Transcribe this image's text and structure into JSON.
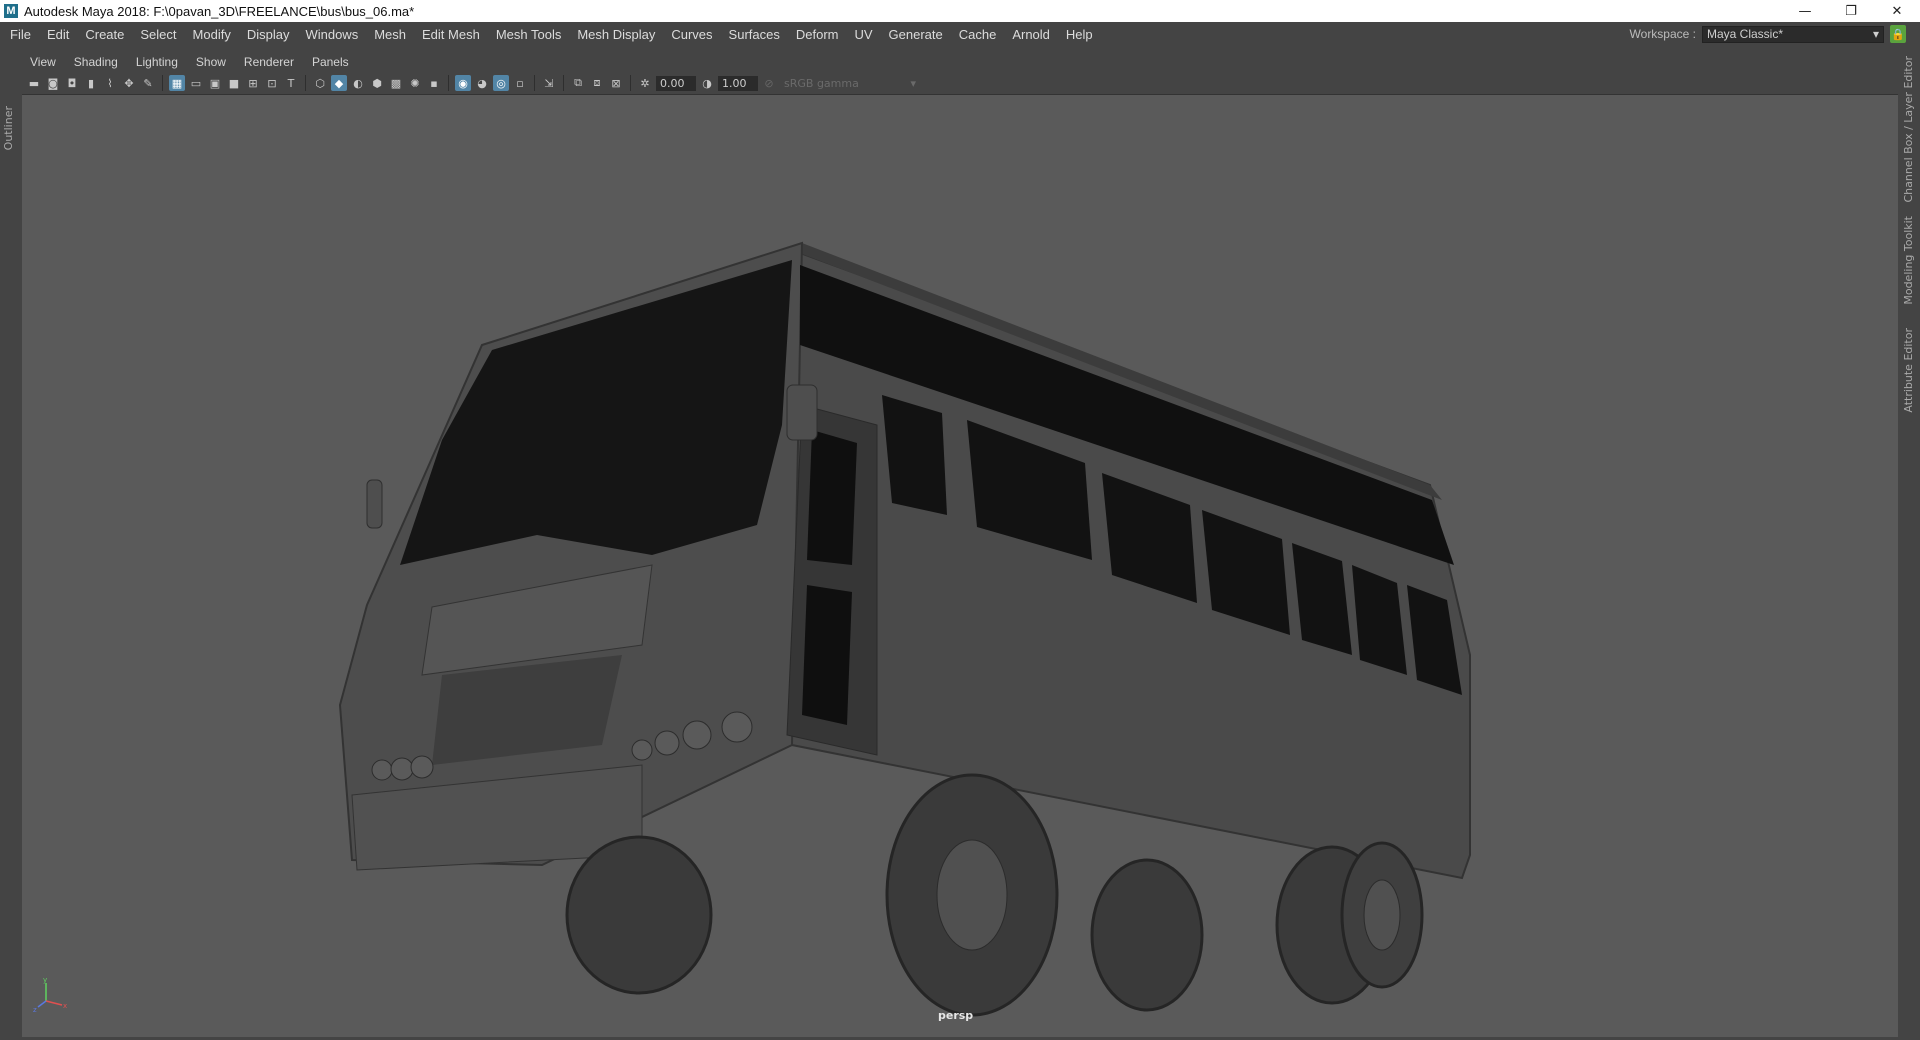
{
  "window": {
    "title": "Autodesk Maya 2018: F:\\0pavan_3D\\FREELANCE\\bus\\bus_06.ma*",
    "app_icon": "M",
    "minimize": "—",
    "restore": "❐",
    "close": "✕"
  },
  "menubar": {
    "items": [
      "File",
      "Edit",
      "Create",
      "Select",
      "Modify",
      "Display",
      "Windows",
      "Mesh",
      "Edit Mesh",
      "Mesh Tools",
      "Mesh Display",
      "Curves",
      "Surfaces",
      "Deform",
      "UV",
      "Generate",
      "Cache",
      "Arnold",
      "Help"
    ]
  },
  "workspace": {
    "label": "Workspace :",
    "value": "Maya Classic*"
  },
  "left_strip": {
    "outliner": "Outliner"
  },
  "right_strip": {
    "channel_box": "Channel Box / Layer Editor",
    "modeling_toolkit": "Modeling Toolkit",
    "attribute_editor": "Attribute Editor"
  },
  "panel_menu": {
    "items": [
      "View",
      "Shading",
      "Lighting",
      "Show",
      "Renderer",
      "Panels"
    ]
  },
  "toolbar": {
    "exposure": "0.00",
    "gamma": "1.00",
    "color_space": "sRGB gamma"
  },
  "viewport": {
    "camera": "persp",
    "background_color": "#5a5a5a",
    "model_color": "#4b4b4b"
  },
  "axis": {
    "x": "x",
    "y": "y",
    "z": "z"
  }
}
